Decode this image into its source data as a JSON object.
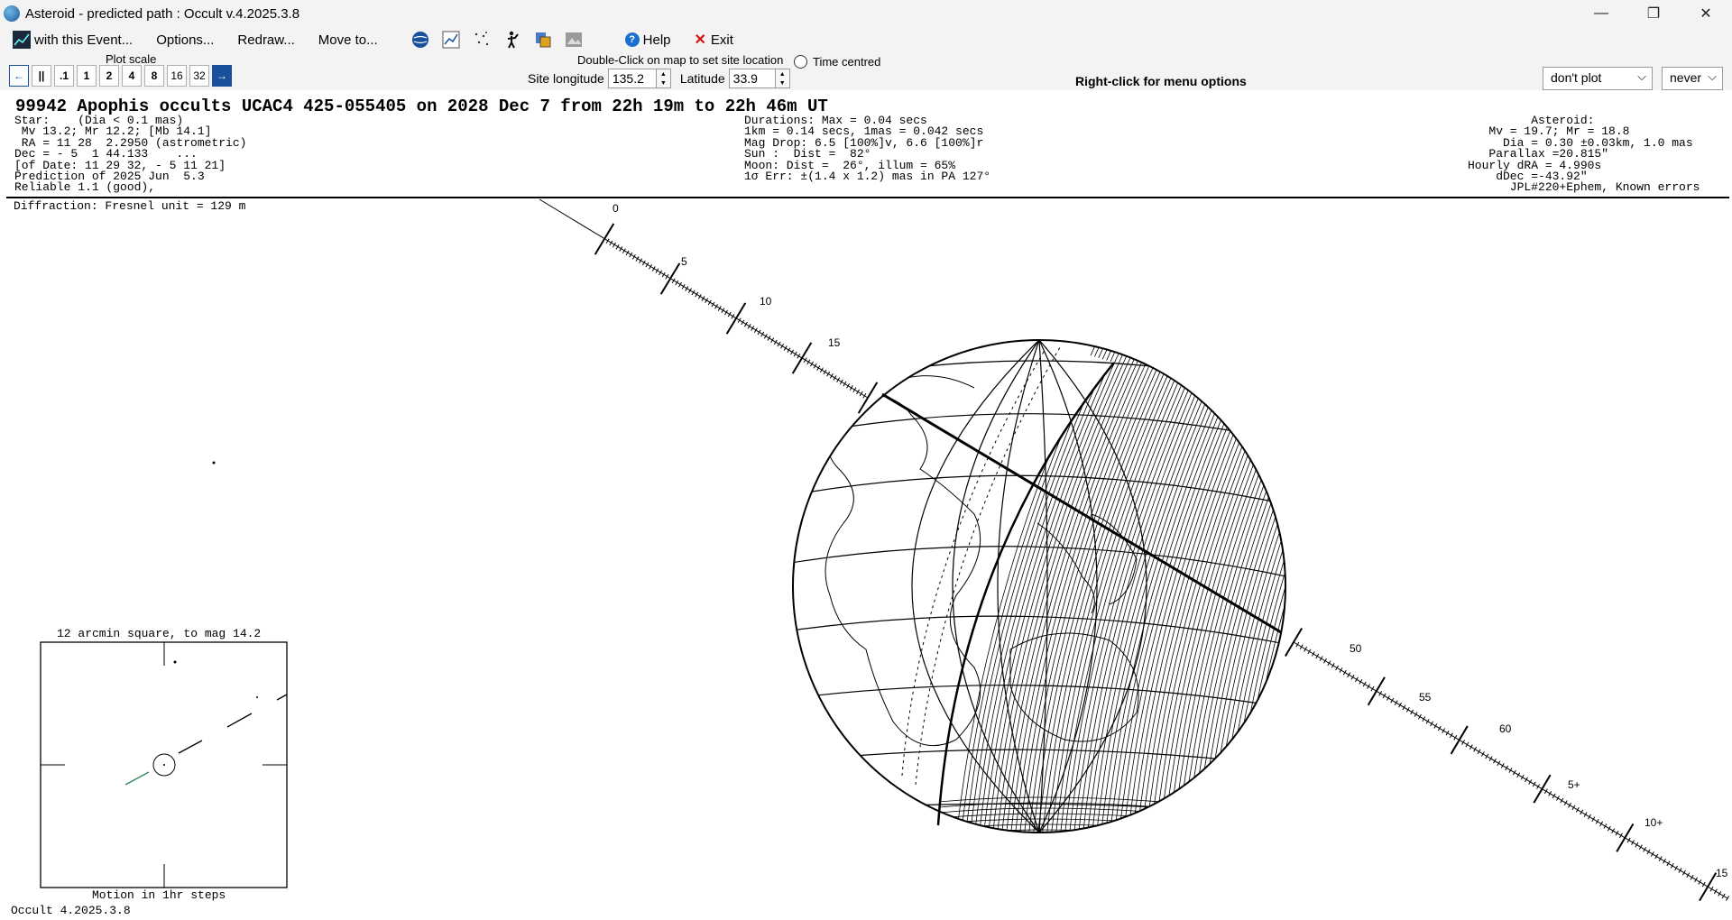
{
  "window": {
    "title": "Asteroid - predicted path : Occult v.4.2025.3.8",
    "min_label": "—",
    "restore_label": "❐",
    "close_label": "✕"
  },
  "menu": {
    "event_label": "with this Event...",
    "options_label": "Options...",
    "redraw_label": "Redraw...",
    "moveto_label": "Move to...",
    "help_label": "Help",
    "exit_label": "Exit"
  },
  "toolbar": {
    "plot_scale_label": "Plot scale",
    "back_label": "←",
    "pause_label": "||",
    "scales": [
      ".1",
      "1",
      "2",
      "4",
      "8",
      "16",
      "32"
    ],
    "forward_label": "→",
    "dbl_click_label": "Double-Click on map to set site location",
    "time_centred_label": "Time centred",
    "site_long_label": "Site longitude",
    "site_long_value": "135.2",
    "lat_label": "Latitude",
    "lat_value": "33.9",
    "right_click_label": "Right-click for menu options",
    "plot_select_value": "don't plot",
    "never_select_value": "never"
  },
  "header": {
    "title": "99942 Apophis occults UCAC4 425-055405 on 2028 Dec  7 from 22h 19m to 22h 46m UT",
    "left": "Star:    (Dia < 0.1 mas)\n Mv 13.2; Mr 12.2; [Mb 14.1]\n RA = 11 28  2.2950 (astrometric)\nDec = - 5  1 44.133    ...\n[of Date: 11 29 32, - 5 11 21]\nPrediction of 2025 Jun  5.3\nReliable 1.1 (good),",
    "middle": "Durations: Max = 0.04 secs\n1km = 0.14 secs, 1mas = 0.042 secs\nMag Drop: 6.5 [100%]v, 6.6 [100%]r\nSun :  Dist =  82°\nMoon: Dist =  26°, illum = 65%\n1σ Err: ±(1.4 x 1.2) mas in PA 127°",
    "right": "         Asteroid:\n   Mv = 19.7; Mr = 18.8\n     Dia = 0.30 ±0.03km, 1.0 mas\n   Parallax =20.815\"\nHourly dRA = 4.990s\n    dDec =-43.92\"\n      JPL#220+Ephem, Known errors",
    "diffraction": "Diffraction: Fresnel unit = 129 m"
  },
  "track": {
    "tick_labels": [
      "0",
      "5",
      "10",
      "15",
      "50",
      "55",
      "60",
      "5+",
      "10+",
      "15"
    ]
  },
  "inset": {
    "title": "12 arcmin square, to mag 14.2",
    "caption": "Motion in 1hr steps"
  },
  "footer": {
    "version": "Occult 4.2025.3.8"
  },
  "colors": {
    "accent": "#1a4f9c",
    "motion_trail": "#2e8b57"
  }
}
